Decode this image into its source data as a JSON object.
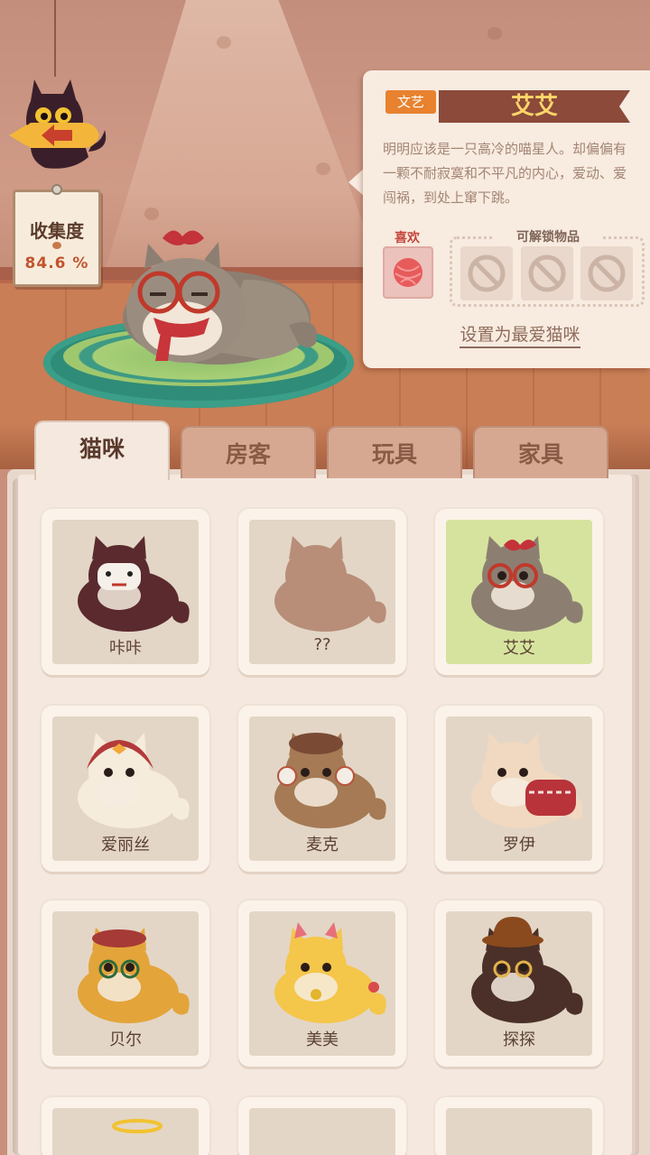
{
  "collection": {
    "title": "收集度",
    "percent": "84.6 %"
  },
  "selected_cat": {
    "tag": "文艺",
    "name": "艾艾",
    "description": "明明应该是一只高冷的喵星人。却偏偏有一颗不耐寂寞和不平凡的内心，爱动、爱闯祸，到处上窜下跳。",
    "likes_label": "喜欢",
    "like_item_icon": "yarn-ball-icon",
    "unlockables_label": "可解锁物品",
    "locked_icon": "locked-slot-icon",
    "favorite_link": "设置为最爱猫咪"
  },
  "tabs": [
    "猫咪",
    "房客",
    "玩具",
    "家具"
  ],
  "active_tab": "猫咪",
  "cats": [
    {
      "name": "咔咔",
      "color": "#5a2a2e",
      "accessory": "mask"
    },
    {
      "name": "??",
      "color": "#b88e79",
      "accessory": "silhouette"
    },
    {
      "name": "艾艾",
      "color": "#8c7f72",
      "accessory": "glasses-bow",
      "selected": true
    },
    {
      "name": "爱丽丝",
      "color": "#f6ecdc",
      "accessory": "bonnet"
    },
    {
      "name": "麦克",
      "color": "#a57a55",
      "accessory": "earmuffs"
    },
    {
      "name": "罗伊",
      "color": "#f0d9c0",
      "accessory": "sweater"
    },
    {
      "name": "贝尔",
      "color": "#e3a43a",
      "accessory": "beret"
    },
    {
      "name": "美美",
      "color": "#f4c64a",
      "accessory": "bell"
    },
    {
      "name": "探探",
      "color": "#4a3028",
      "accessory": "bowler"
    }
  ],
  "colors": {
    "accent": "#e8822f",
    "name_banner": "#8b4a3a",
    "name_text": "#ffd66a",
    "selected_card": "#d6e39e"
  }
}
